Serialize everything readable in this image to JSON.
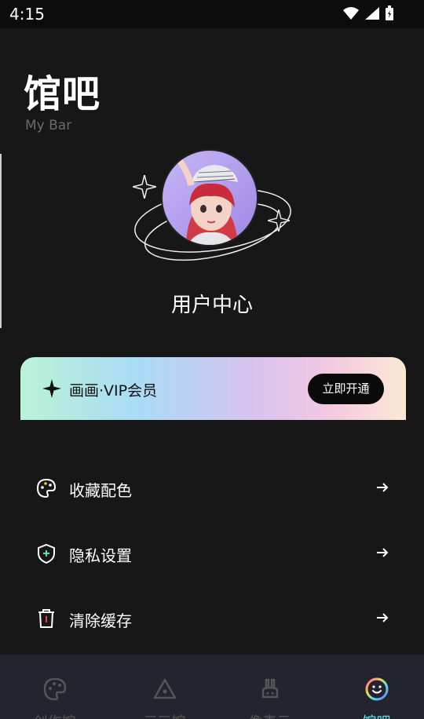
{
  "status_bar": {
    "time": "4:15"
  },
  "header": {
    "title": "馆吧",
    "subtitle": "My Bar"
  },
  "profile": {
    "label": "用户中心"
  },
  "vip": {
    "label": "画画·VIP会员",
    "button": "立即开通"
  },
  "menu": [
    {
      "label": "收藏配色",
      "icon": "palette-icon"
    },
    {
      "label": "隐私设置",
      "icon": "shield-icon"
    },
    {
      "label": "清除缓存",
      "icon": "trash-icon"
    }
  ],
  "tabs": [
    {
      "label": "创作馆",
      "icon": "palette-icon",
      "active": false
    },
    {
      "label": "三三馆",
      "icon": "triangle-icon",
      "active": false
    },
    {
      "label": "像素云",
      "icon": "rabbit-icon",
      "active": false
    },
    {
      "label": "馆吧",
      "icon": "smile-icon",
      "active": true
    }
  ],
  "colors": {
    "background": "#171717",
    "tab_active": "#4fe0e8",
    "tab_bar": "#23242d"
  }
}
